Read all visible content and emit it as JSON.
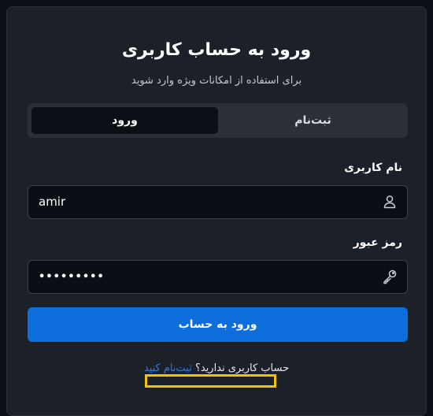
{
  "header": {
    "title": "ورود به حساب کاربری",
    "subtitle": "برای استفاده از امکانات ویژه وارد شوید"
  },
  "tabs": {
    "login": "ورود",
    "signup": "ثبت‌نام",
    "active": "login"
  },
  "form": {
    "username_label": "نام کاربری",
    "username_value": "amir",
    "password_label": "رمز عبور",
    "password_value": "•••••••••",
    "submit_label": "ورود به حساب"
  },
  "footer": {
    "prompt": "حساب کاربری ندارید؟ ",
    "link": "ثبت‌نام کنید"
  },
  "colors": {
    "background": "#0d1016",
    "card": "#1c2029",
    "primary": "#0d6edb",
    "link": "#2b7de0",
    "highlight": "#f2c10a"
  }
}
